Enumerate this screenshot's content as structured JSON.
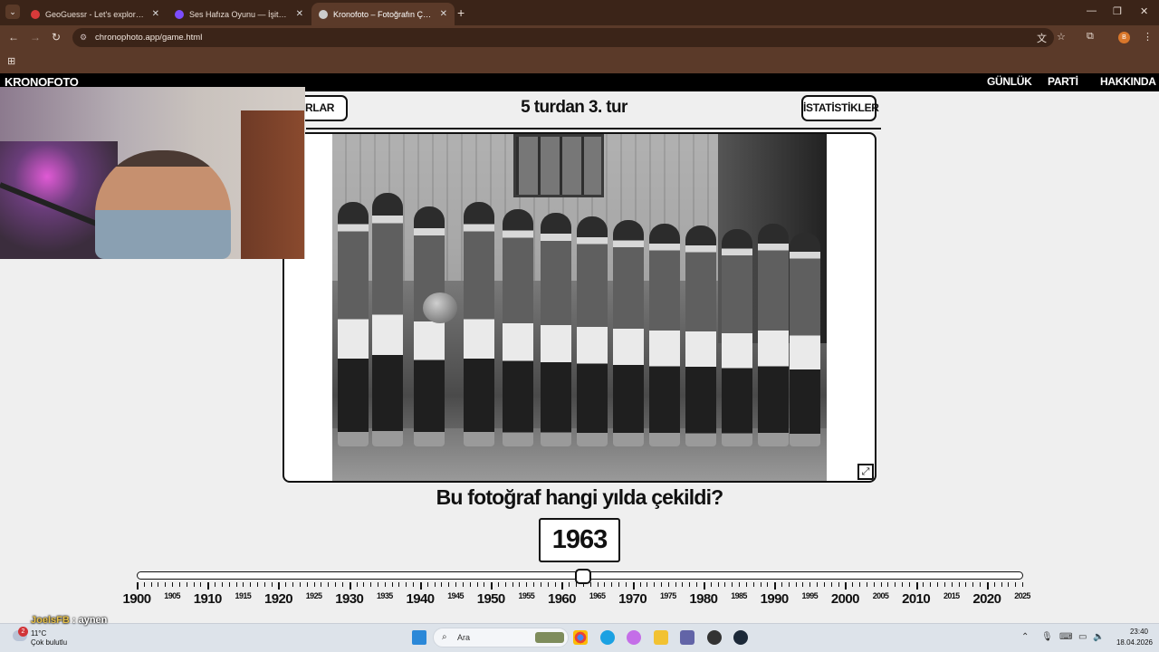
{
  "browser": {
    "tabs": [
      {
        "title": "GeoGuessr - Let's explore the w",
        "favicon_color": "#d83a3a",
        "active": false
      },
      {
        "title": "Ses Hafıza Oyunu — İşitme Yet",
        "favicon_color": "#7c4dff",
        "active": false
      },
      {
        "title": "Kronofoto – Fotoğrafın Çekildiğ",
        "favicon_color": "#cccccc",
        "active": true
      }
    ],
    "url": "chronophoto.app/game.html",
    "profile_initial": "B"
  },
  "site": {
    "brand": "KRONOFOTO",
    "nav": [
      "GÜNLÜK",
      "PARTİ",
      "HAKKINDA"
    ],
    "settings_label": "AYARLAR",
    "stats_label": "İSTATİSTİKLER",
    "round_title": "5 turdan 3. tur",
    "question": "Bu fotoğraf hangi yılda çekildi?",
    "year_value": "1963",
    "slider": {
      "min": 1900,
      "max": 2025,
      "value": 1963,
      "major_labels": [
        "1900",
        "1910",
        "1920",
        "1930",
        "1940",
        "1950",
        "1960",
        "1970",
        "1980",
        "1990",
        "2000",
        "2010",
        "2020"
      ],
      "minor_labels": [
        "1905",
        "1915",
        "1925",
        "1935",
        "1945",
        "1955",
        "1965",
        "1975",
        "1985",
        "1995",
        "2005",
        "2015",
        "2025"
      ]
    }
  },
  "stream_chat": {
    "user": "JoelsFB",
    "message": ": aynen"
  },
  "taskbar": {
    "weather_badge": "2",
    "weather_temp": "11°C",
    "weather_desc": "Çok bulutlu",
    "search_placeholder": "Ara",
    "time": "23:40",
    "date": "18.04.2026"
  }
}
